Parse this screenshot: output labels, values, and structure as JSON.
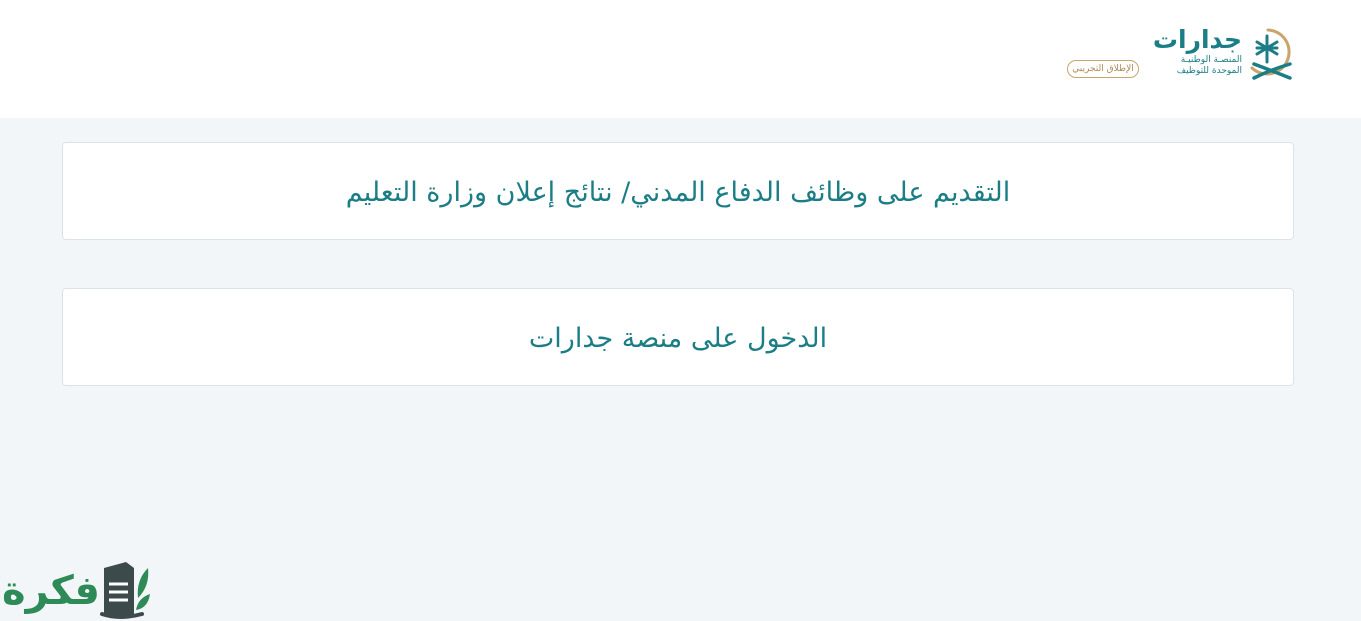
{
  "header": {
    "logo": {
      "name": "جدارات",
      "tagline_line1": "المنصـة الوطنيـة",
      "tagline_line2": "الموحدة للتوظيف",
      "icon": "jadarat-palm-emblem-icon"
    },
    "beta_badge": "الإطلاق التجريبي"
  },
  "main": {
    "cards": [
      {
        "label": "التقديم على وظائف الدفاع المدني/ نتائج إعلان وزارة التعليم"
      },
      {
        "label": "الدخول على منصة جدارات"
      }
    ]
  },
  "watermark": {
    "text": "فكرة",
    "icon": "book-leaf-icon"
  },
  "colors": {
    "accent": "#1b7e86",
    "gold": "#c9a46b",
    "background": "#f3f6f8",
    "card_border": "#dde2e6",
    "watermark_green": "#2e8b57",
    "watermark_dark": "#3d4a4c"
  }
}
